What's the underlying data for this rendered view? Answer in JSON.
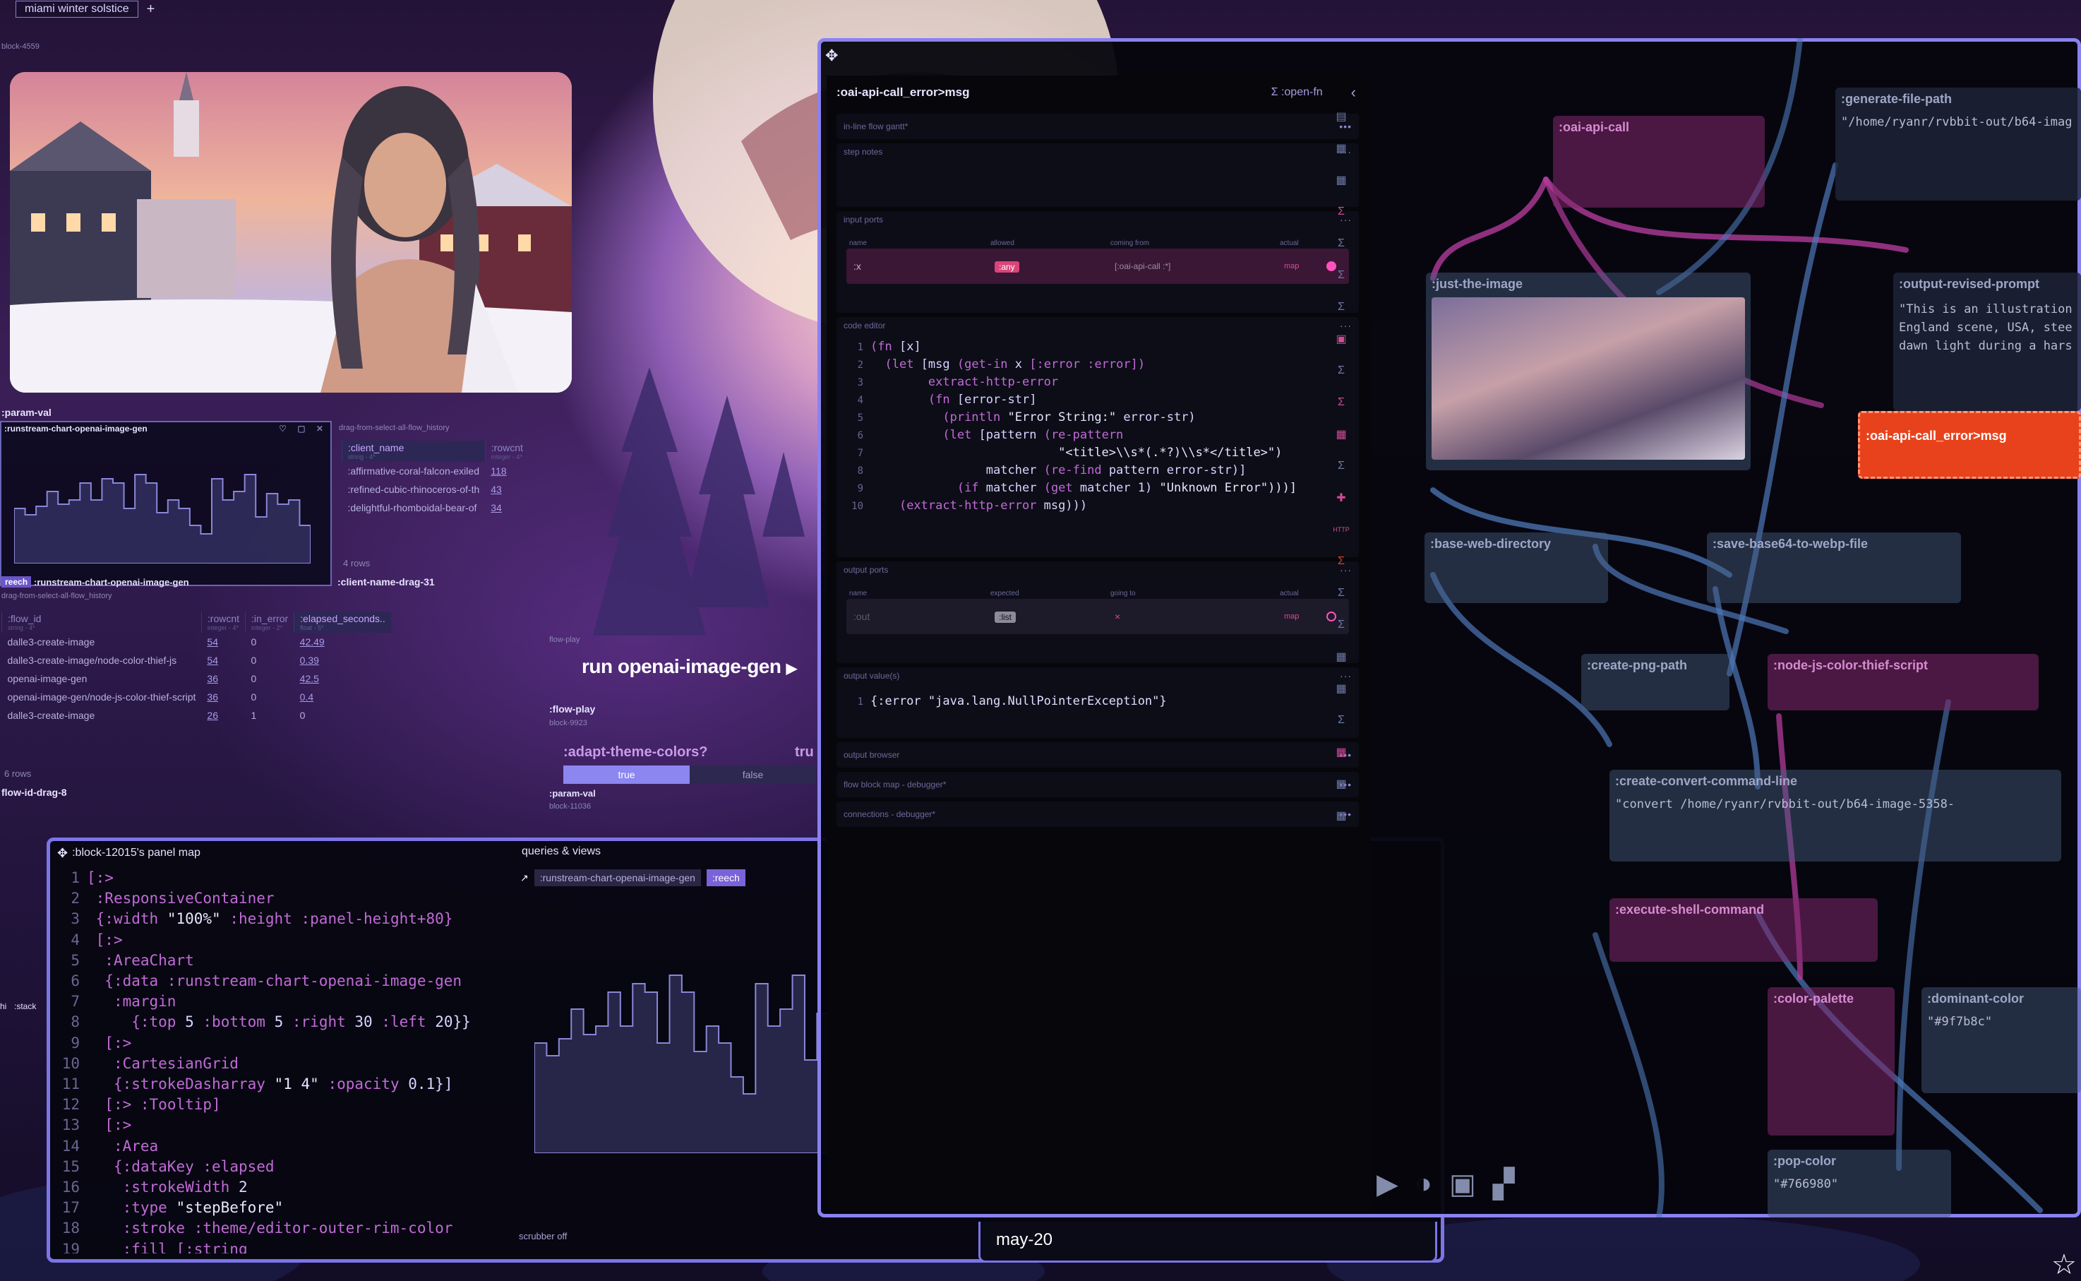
{
  "tabs": {
    "active": "miami winter solstice",
    "add": "+"
  },
  "image_block": {
    "id": "block-4559",
    "param_label": ":param-val"
  },
  "mini_chart": {
    "title": ":runstream-chart-openai-image-gen",
    "footer_tag": "reech",
    "footer_label": ":runstream-chart-openai-image-gen",
    "icons": "♡ ▢ ✕"
  },
  "client_table": {
    "caption": "drag-from-select-all-flow_history",
    "headers": [
      {
        "name": ":client_name",
        "type": "string - 4*"
      },
      {
        "name": ":rowcnt",
        "type": "integer - 4*"
      }
    ],
    "rows": [
      {
        "name": ":affirmative-coral-falcon-exiled",
        "count": "118"
      },
      {
        "name": ":refined-cubic-rhinoceros-of-th",
        "count": "43"
      },
      {
        "name": ":delightful-rhomboidal-bear-of",
        "count": "34"
      }
    ],
    "rows_label": "4 rows",
    "drag_label": ":client-name-drag-31"
  },
  "flow_table": {
    "caption": "drag-from-select-all-flow_history",
    "headers": [
      {
        "name": ":flow_id",
        "type": "string - 4*"
      },
      {
        "name": ":rowcnt",
        "type": "integer - 4*"
      },
      {
        "name": ":in_error",
        "type": "integer - 2*"
      },
      {
        "name": ":elapsed_seconds..",
        "type": "float - 5*"
      }
    ],
    "rows": [
      {
        "flow": "dalle3-create-image",
        "rowcnt": "54",
        "err": "0",
        "elapsed": "42.49"
      },
      {
        "flow": "dalle3-create-image/node-color-thief-js",
        "rowcnt": "54",
        "err": "0",
        "elapsed": "0.39"
      },
      {
        "flow": "openai-image-gen",
        "rowcnt": "36",
        "err": "0",
        "elapsed": "42.5"
      },
      {
        "flow": "openai-image-gen/node-js-color-thief-script",
        "rowcnt": "36",
        "err": "0",
        "elapsed": "0.4"
      },
      {
        "flow": "dalle3-create-image",
        "rowcnt": "26",
        "err": "1",
        "elapsed": "0"
      }
    ],
    "rows_label": "6 rows",
    "drag_label": "flow-id-drag-8"
  },
  "flow_play": {
    "caption": "flow-play",
    "run_label": "run openai-image-gen",
    "block_label": ":flow-play",
    "block_id": "block-9923"
  },
  "theme_toggle": {
    "label": ":adapt-theme-colors?",
    "true_label": "true",
    "false_label": "false",
    "param_label": ":param-val",
    "param_id": "block-11036",
    "clip": "tru"
  },
  "panel_map": {
    "title": ":block-12015's panel map",
    "queries_title": "queries & views",
    "query_label": ":runstream-chart-openai-image-gen",
    "query_tag": ":reech",
    "scrubber": "scrubber off",
    "code_lines": [
      "[:>",
      " :ResponsiveContainer",
      " {:width \"100%\" :height :panel-height+80}",
      " [:>",
      "  :AreaChart",
      "  {:data :runstream-chart-openai-image-gen",
      "   :margin",
      "     {:top 5 :bottom 5 :right 30 :left 20}}",
      "  [:>",
      "   :CartesianGrid",
      "   {:strokeDasharray \"1 4\" :opacity 0.1}]",
      "  [:> :Tooltip]",
      "  [:>",
      "   :Area",
      "   {:dataKey :elapsed",
      "    :strokeWidth 2",
      "    :type \"stepBefore\"",
      "    :stroke :theme/editor-outer-rim-color",
      "    :fill [:string"
    ]
  },
  "editor": {
    "title": ":oai-api-call_error>msg",
    "open_fn": ":open-fn",
    "sections": {
      "gantt": "in-line flow gantt*",
      "notes": "step notes",
      "inputs": "input ports",
      "code": "code editor",
      "outputs": "output ports",
      "values": "output value(s)",
      "browser": "output browser",
      "blockmap": "flow block map - debugger*",
      "connections": "connections - debugger*"
    },
    "input_headers": [
      "name",
      "allowed",
      "coming from",
      "actual"
    ],
    "input_port": {
      "name": ":x",
      "allowed": ":any",
      "from": "[:oai-api-call :*]",
      "actual": "map"
    },
    "output_headers": [
      "name",
      "expected",
      "going to",
      "actual"
    ],
    "output_port": {
      "name": ":out",
      "expected": ":list",
      "to": "×",
      "actual": "map"
    },
    "code_lines": [
      "(fn [x]",
      "  (let [msg (get-in x [:error :error])",
      "        extract-http-error",
      "        (fn [error-str]",
      "          (println \"Error String:\" error-str)",
      "          (let [pattern (re-pattern",
      "                          \"<title>\\\\s*(.*?)\\\\s*</title>\")",
      "                matcher (re-find pattern error-str)]",
      "            (if matcher (get matcher 1) \"Unknown Error\")))]",
      "    (extract-http-error msg)))"
    ],
    "output_value": "{:error \"java.lang.NullPointerException\"}"
  },
  "canvas": {
    "nodes": {
      "oai_api_call": ":oai-api-call",
      "generate_file_path": ":generate-file-path",
      "generate_file_path_val": "\"/home/ryanr/rvbbit-out/b64-imag",
      "just_the_image": ":just-the-image",
      "output_revised_prompt": ":output-revised-prompt",
      "output_revised_prompt_val": "\"This is an illustration\nEngland scene, USA, stee\ndawn light during a hars",
      "error_msg": ":oai-api-call_error>msg",
      "base_web_directory": ":base-web-directory",
      "save_base64": ":save-base64-to-webp-file",
      "create_png_path": ":create-png-path",
      "node_js_color_thief": ":node-js-color-thief-script",
      "create_convert_command": ":create-convert-command-line",
      "create_convert_val": "\"convert /home/ryanr/rvbbit-out/b64-image-5358-",
      "execute_shell": ":execute-shell-command",
      "color_palette": ":color-palette",
      "dominant_color": ":dominant-color",
      "dominant_color_val": "\"#9f7b8c\"",
      "pop_color": ":pop-color",
      "pop_color_val": "\"#766980\""
    }
  },
  "date_label": "may-20",
  "side_labels": {
    "hi": "hi",
    "stack": ":stack"
  },
  "chart_data": [
    {
      "type": "area",
      "title": ":runstream-chart-openai-image-gen",
      "values": [
        26,
        23,
        27,
        34,
        28,
        30,
        38,
        30,
        40,
        38,
        26,
        42,
        38,
        24,
        30,
        26,
        18,
        14,
        40,
        30,
        34,
        42,
        22,
        33,
        28,
        30,
        18
      ],
      "ylim": [
        0,
        50
      ]
    }
  ]
}
